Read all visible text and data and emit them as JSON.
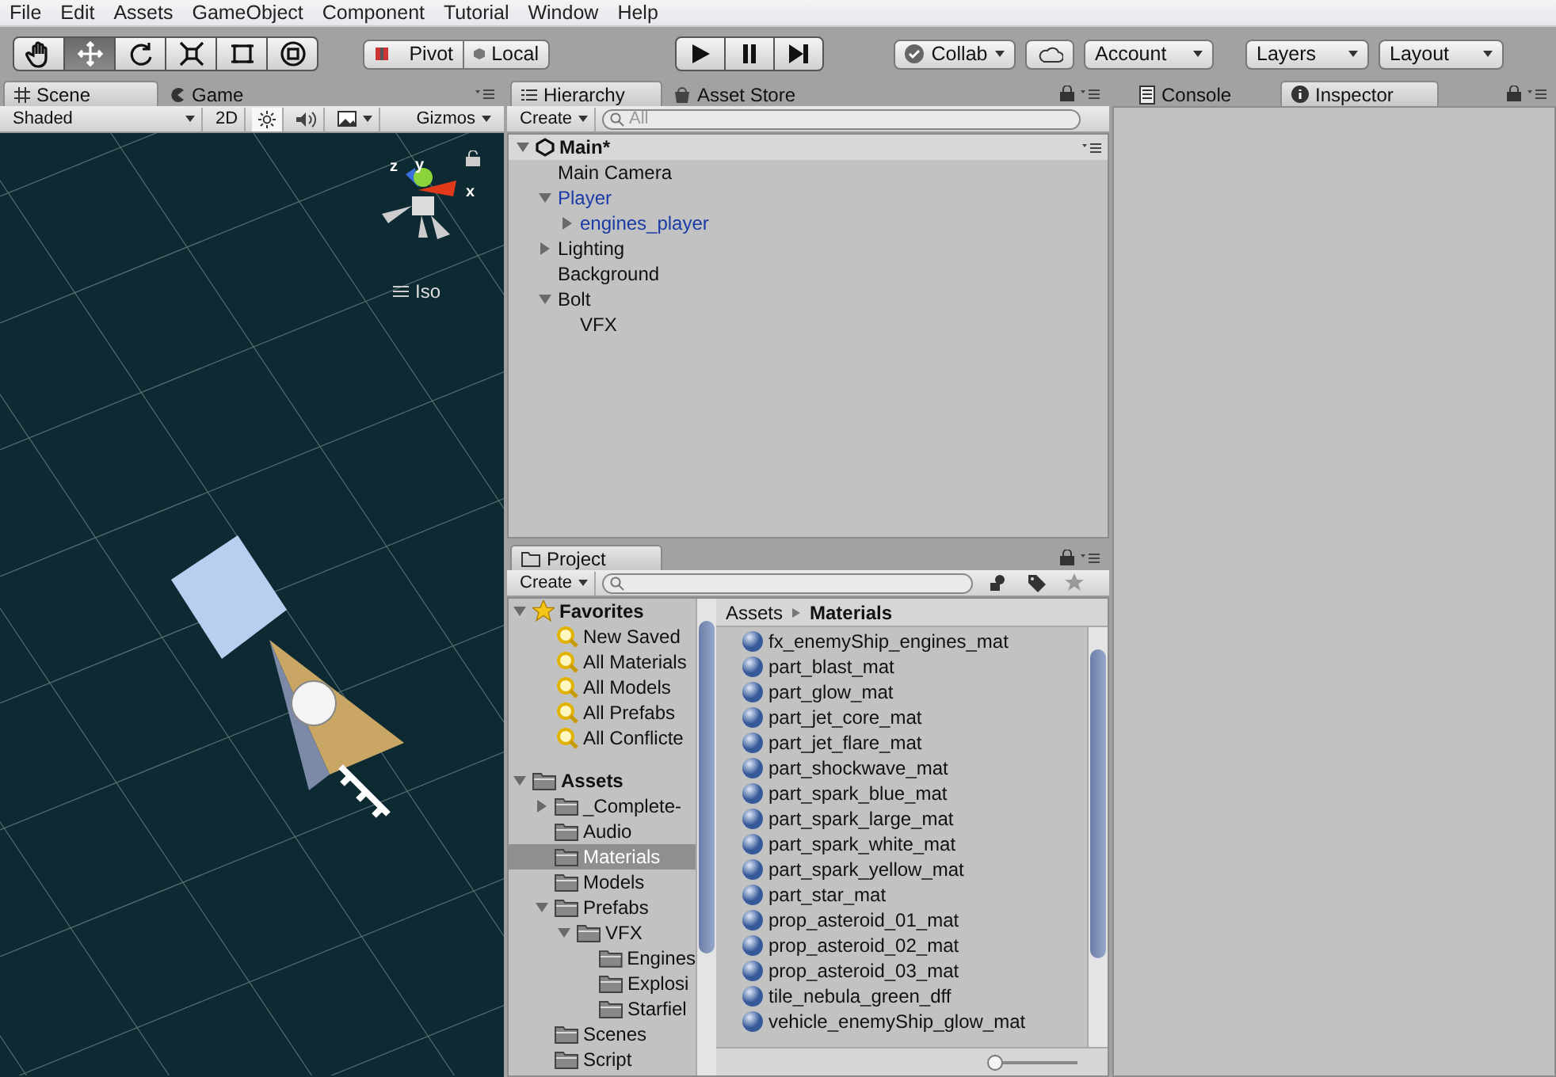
{
  "menu": [
    "File",
    "Edit",
    "Assets",
    "GameObject",
    "Component",
    "Tutorial",
    "Window",
    "Help"
  ],
  "toolbar": {
    "tools": [
      {
        "kind": "hand",
        "selected": false
      },
      {
        "kind": "move",
        "selected": true
      },
      {
        "kind": "rotate",
        "selected": false
      },
      {
        "kind": "scale",
        "selected": false
      },
      {
        "kind": "rect",
        "selected": false
      },
      {
        "kind": "transform",
        "selected": false
      }
    ],
    "pivot": [
      "Pivot",
      "Local"
    ],
    "play": [
      {
        "kind": "play",
        "selected": false
      },
      {
        "kind": "pause",
        "selected": false
      },
      {
        "kind": "step",
        "selected": false
      }
    ],
    "collab": "Collab",
    "account": "Account",
    "layers": "Layers",
    "layout": "Layout"
  },
  "scene_panel": {
    "tabs": [
      {
        "kind": "scene",
        "label": "Scene",
        "selected": true
      },
      {
        "kind": "game",
        "label": "Game",
        "selected": false
      }
    ],
    "shading": "Shaded",
    "mode_2d": "2D",
    "lighting_on": true,
    "audio_on": false,
    "gizmos": "Gizmos",
    "axes": [
      "x",
      "y",
      "z"
    ],
    "projection": "Iso"
  },
  "hierarchy": {
    "tabs": [
      {
        "kind": "hierarchy",
        "label": "Hierarchy",
        "selected": true
      },
      {
        "kind": "store",
        "label": "Asset Store",
        "selected": false
      }
    ],
    "create": "Create",
    "search_placeholder": "All",
    "scene": "Main*",
    "items": [
      {
        "label": "Main Camera",
        "kind": "object"
      },
      {
        "label": "Player",
        "kind": "prefab",
        "expanded": true,
        "children": [
          {
            "label": "engines_player",
            "kind": "prefab",
            "expanded": false
          }
        ]
      },
      {
        "label": "Lighting",
        "kind": "object",
        "expanded": false
      },
      {
        "label": "Background",
        "kind": "object"
      },
      {
        "label": "Bolt",
        "kind": "object",
        "expanded": true,
        "children": [
          {
            "label": "VFX",
            "kind": "object"
          }
        ]
      }
    ]
  },
  "project": {
    "tab": "Project",
    "create": "Create",
    "favorites": {
      "label": "Favorites",
      "items": [
        "New Saved",
        "All Materials",
        "All Models",
        "All Prefabs",
        "All Conflicte"
      ]
    },
    "assets": {
      "label": "Assets",
      "children": [
        {
          "label": "_Complete-",
          "expanded": false,
          "selected": false
        },
        {
          "label": "Audio",
          "selected": false
        },
        {
          "label": "Materials",
          "selected": true
        },
        {
          "label": "Models",
          "selected": false
        },
        {
          "label": "Prefabs",
          "expanded": true,
          "selected": false,
          "children": [
            {
              "label": "VFX",
              "expanded": true,
              "selected": false,
              "children": [
                {
                  "label": "Engines",
                  "selected": false
                },
                {
                  "label": "Explosi",
                  "selected": false
                },
                {
                  "label": "Starfiel",
                  "selected": false
                }
              ]
            }
          ]
        },
        {
          "label": "Scenes",
          "selected": false
        },
        {
          "label": "Script",
          "selected": false
        }
      ]
    },
    "breadcrumb": [
      "Assets",
      "Materials"
    ],
    "icon_size": {
      "level": 0
    },
    "files": [
      "fx_enemyShip_engines_mat",
      "part_blast_mat",
      "part_glow_mat",
      "part_jet_core_mat",
      "part_jet_flare_mat",
      "part_shockwave_mat",
      "part_spark_blue_mat",
      "part_spark_large_mat",
      "part_spark_white_mat",
      "part_spark_yellow_mat",
      "part_star_mat",
      "prop_asteroid_01_mat",
      "prop_asteroid_02_mat",
      "prop_asteroid_03_mat",
      "tile_nebula_green_dff",
      "vehicle_enemyShip_glow_mat"
    ]
  },
  "inspector": {
    "tabs": [
      {
        "kind": "console",
        "label": "Console",
        "selected": false
      },
      {
        "kind": "inspector",
        "label": "Inspector",
        "selected": true
      }
    ]
  }
}
